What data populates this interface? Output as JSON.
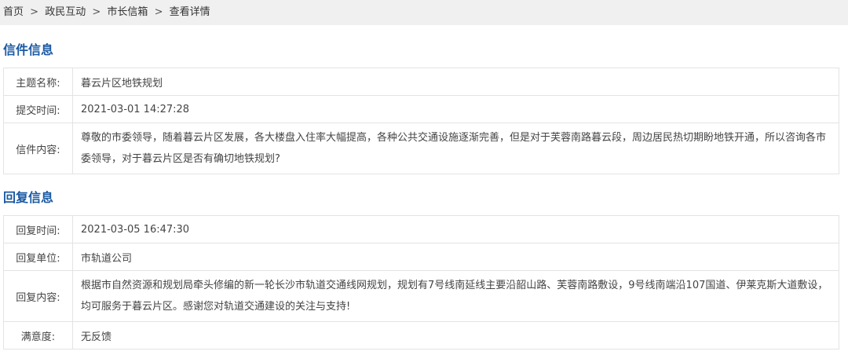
{
  "breadcrumb": {
    "items": [
      "首页",
      "政民互动",
      "市长信箱",
      "查看详情"
    ],
    "separator": ">"
  },
  "letter": {
    "title": "信件信息",
    "rows": [
      {
        "label": "主题名称:",
        "value": "暮云片区地铁规划"
      },
      {
        "label": "提交时间:",
        "value": "2021-03-01 14:27:28"
      },
      {
        "label": "信件内容:",
        "value": "尊敬的市委领导，随着暮云片区发展，各大楼盘入住率大幅提高，各种公共交通设施逐渐完善，但是对于芙蓉南路暮云段，周边居民热切期盼地铁开通，所以咨询各市委领导，对于暮云片区是否有确切地铁规划?"
      }
    ]
  },
  "reply": {
    "title": "回复信息",
    "rows": [
      {
        "label": "回复时间:",
        "value": "2021-03-05 16:47:30"
      },
      {
        "label": "回复单位:",
        "value": "市轨道公司"
      },
      {
        "label": "回复内容:",
        "value": "根据市自然资源和规划局牵头修编的新一轮长沙市轨道交通线网规划，规划有7号线南延线主要沿韶山路、芙蓉南路敷设，9号线南端沿107国道、伊莱克斯大道敷设，均可服务于暮云片区。感谢您对轨道交通建设的关注与支持!"
      },
      {
        "label": "满意度:",
        "value": "无反馈"
      }
    ]
  },
  "colors": {
    "section_title": "#1b5aa3",
    "breadcrumb_bg": "#f0f0f0",
    "border": "#e3e3e3"
  }
}
